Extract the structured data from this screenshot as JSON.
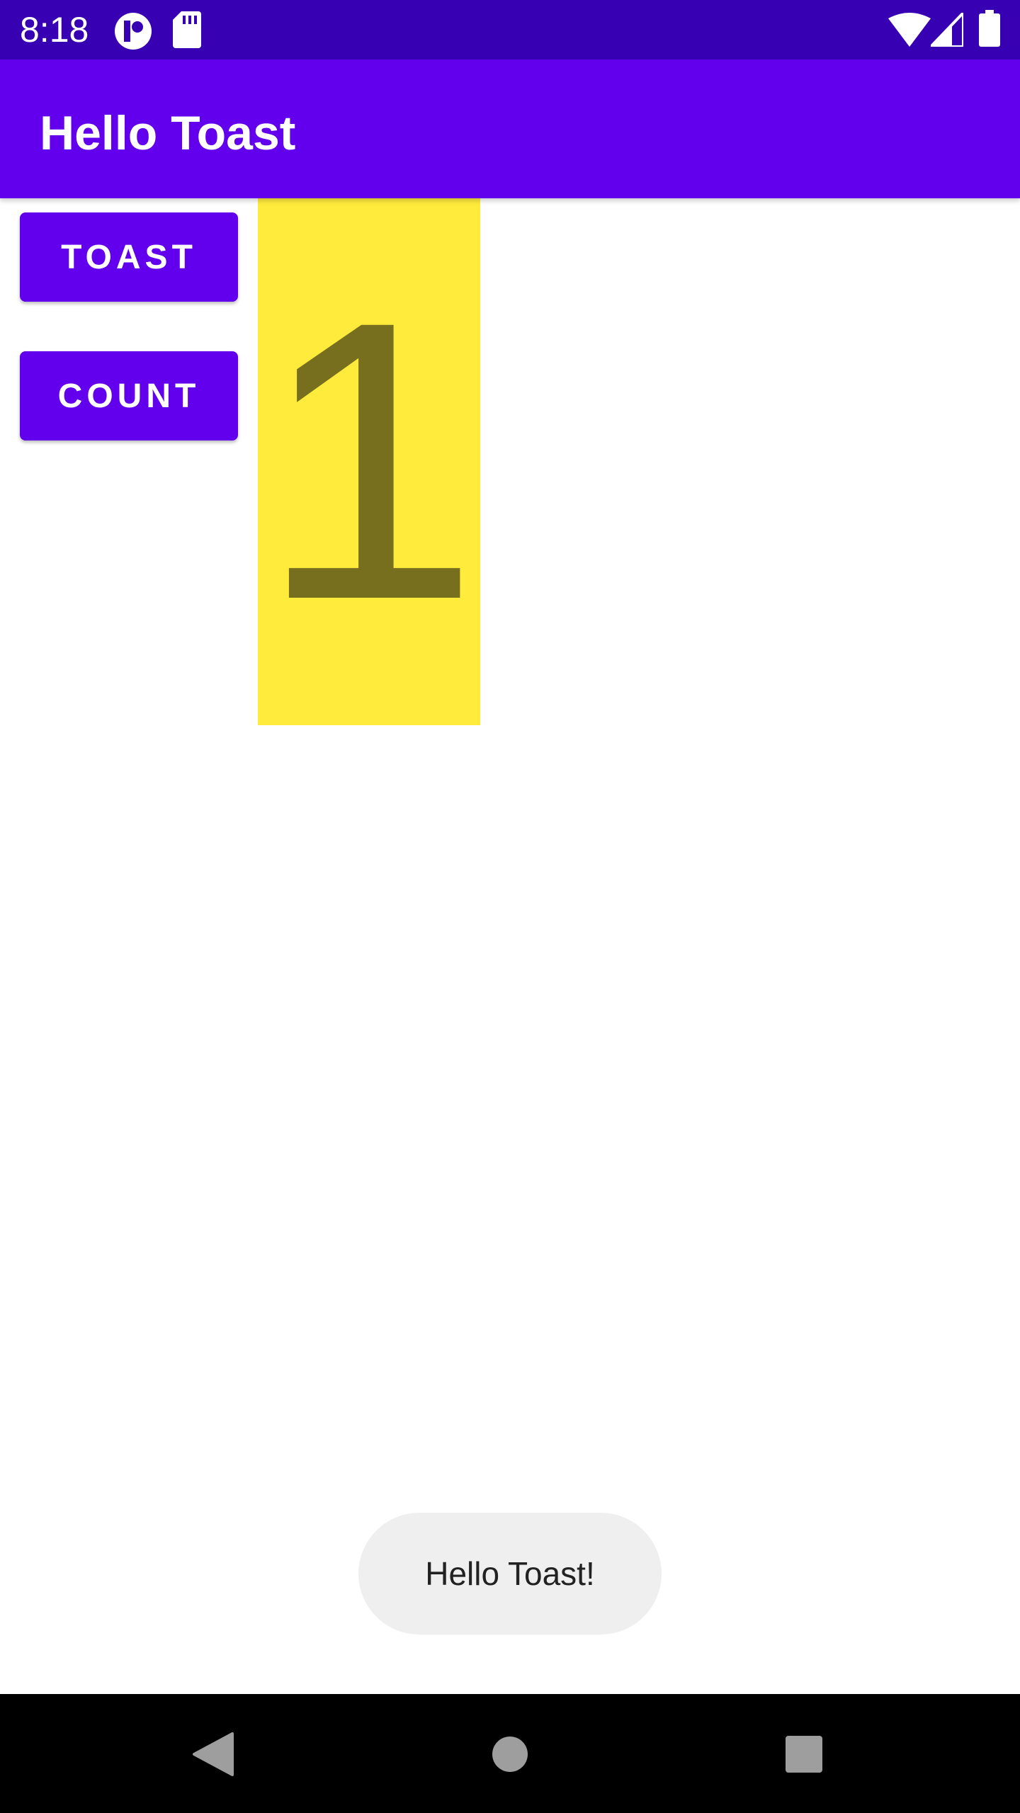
{
  "status_bar": {
    "time": "8:18",
    "left_icons": [
      "app-notification-icon",
      "sd-card-icon"
    ],
    "right_icons": [
      "wifi-icon",
      "cellular-signal-icon",
      "battery-icon"
    ]
  },
  "app_bar": {
    "title": "Hello Toast"
  },
  "buttons": {
    "toast_label": "TOAST",
    "count_label": "COUNT"
  },
  "counter": {
    "value": "1"
  },
  "toast": {
    "message": "Hello Toast!"
  },
  "navigation": {
    "icons": [
      "back-icon",
      "home-icon",
      "recents-icon"
    ]
  },
  "colors": {
    "status_bar": "#3700b3",
    "primary": "#6200ee",
    "count_background": "#ffeb3b",
    "count_text": "#776e1e",
    "toast_background": "#efefef",
    "navigation_bar": "#000000"
  }
}
